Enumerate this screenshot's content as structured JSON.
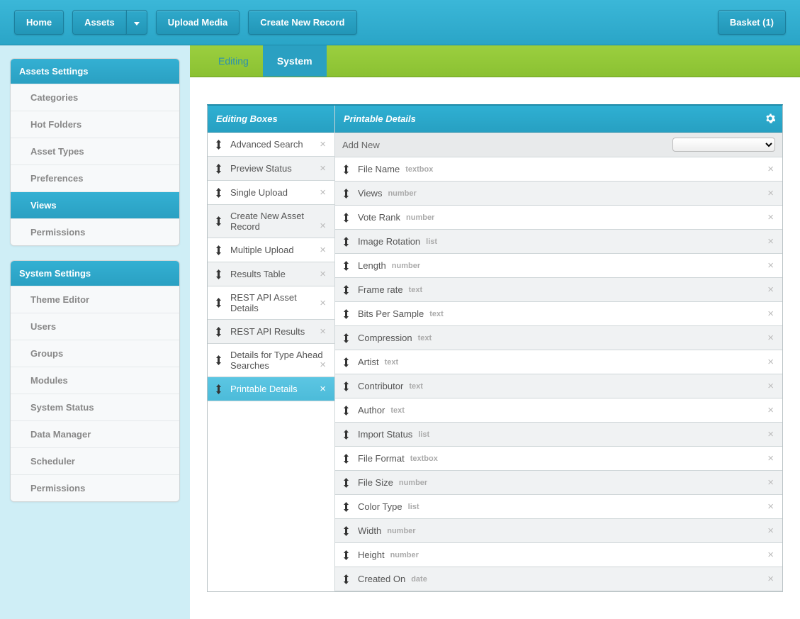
{
  "topbar": {
    "home": "Home",
    "assets": "Assets",
    "upload": "Upload Media",
    "create": "Create New Record",
    "basket": "Basket (1)"
  },
  "sidebar": {
    "assets_settings": {
      "title": "Assets Settings",
      "items": [
        {
          "label": "Categories",
          "active": false
        },
        {
          "label": "Hot Folders",
          "active": false
        },
        {
          "label": "Asset Types",
          "active": false
        },
        {
          "label": "Preferences",
          "active": false
        },
        {
          "label": "Views",
          "active": true
        },
        {
          "label": "Permissions",
          "active": false
        }
      ]
    },
    "system_settings": {
      "title": "System Settings",
      "items": [
        {
          "label": "Theme Editor"
        },
        {
          "label": "Users"
        },
        {
          "label": "Groups"
        },
        {
          "label": "Modules"
        },
        {
          "label": "System Status"
        },
        {
          "label": "Data Manager"
        },
        {
          "label": "Scheduler"
        },
        {
          "label": "Permissions"
        }
      ]
    }
  },
  "tabs": {
    "editing": "Editing",
    "system": "System"
  },
  "columns": {
    "left_title": "Editing Boxes",
    "right_title": "Printable Details",
    "add_new": "Add New"
  },
  "editing_boxes": [
    {
      "label": "Advanced Search",
      "active": false,
      "multi": false
    },
    {
      "label": "Preview Status",
      "active": false,
      "multi": false
    },
    {
      "label": "Single Upload",
      "active": false,
      "multi": false
    },
    {
      "label": "Create New Asset Record",
      "active": false,
      "multi": true
    },
    {
      "label": "Multiple Upload",
      "active": false,
      "multi": false
    },
    {
      "label": "Results Table",
      "active": false,
      "multi": false
    },
    {
      "label": "REST API Asset Details",
      "active": false,
      "multi": false
    },
    {
      "label": "REST API Results",
      "active": false,
      "multi": false
    },
    {
      "label": "Details for Type Ahead Searches",
      "active": false,
      "multi": true
    },
    {
      "label": "Printable Details",
      "active": true,
      "multi": false
    }
  ],
  "printable_details": [
    {
      "label": "File Name",
      "type": "textbox"
    },
    {
      "label": "Views",
      "type": "number"
    },
    {
      "label": "Vote Rank",
      "type": "number"
    },
    {
      "label": "Image Rotation",
      "type": "list"
    },
    {
      "label": "Length",
      "type": "number"
    },
    {
      "label": "Frame rate",
      "type": "text"
    },
    {
      "label": "Bits Per Sample",
      "type": "text"
    },
    {
      "label": "Compression",
      "type": "text"
    },
    {
      "label": "Artist",
      "type": "text"
    },
    {
      "label": "Contributor",
      "type": "text"
    },
    {
      "label": "Author",
      "type": "text"
    },
    {
      "label": "Import Status",
      "type": "list"
    },
    {
      "label": "File Format",
      "type": "textbox"
    },
    {
      "label": "File Size",
      "type": "number"
    },
    {
      "label": "Color Type",
      "type": "list"
    },
    {
      "label": "Width",
      "type": "number"
    },
    {
      "label": "Height",
      "type": "number"
    },
    {
      "label": "Created On",
      "type": "date"
    }
  ]
}
